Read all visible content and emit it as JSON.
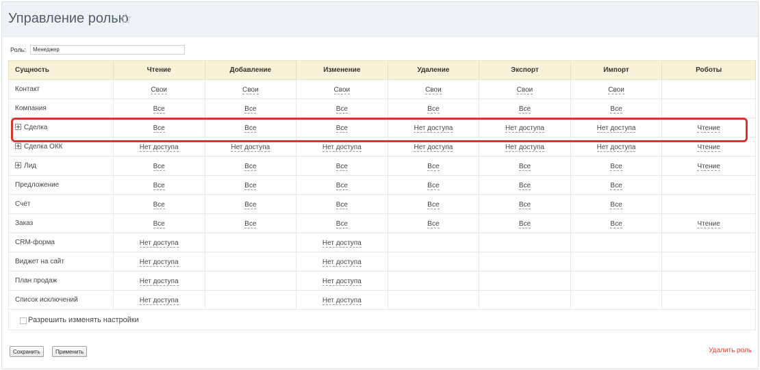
{
  "header": {
    "title": "Управление ролью"
  },
  "role": {
    "label": "Роль:",
    "value": "Менеджер"
  },
  "table": {
    "columns": [
      "Сущность",
      "Чтение",
      "Добавление",
      "Изменение",
      "Удаление",
      "Экспорт",
      "Импорт",
      "Роботы"
    ],
    "rows": [
      {
        "entity": "Контакт",
        "expandable": false,
        "cells": [
          "Свои",
          "Свои",
          "Свои",
          "Свои",
          "Свои",
          "Свои",
          ""
        ]
      },
      {
        "entity": "Компания",
        "expandable": false,
        "cells": [
          "Все",
          "Все",
          "Все",
          "Все",
          "Все",
          "Все",
          ""
        ]
      },
      {
        "entity": "Сделка",
        "expandable": true,
        "cells": [
          "Все",
          "Все",
          "Все",
          "Нет доступа",
          "Нет доступа",
          "Нет доступа",
          "Чтение"
        ]
      },
      {
        "entity": "Сделка ОКК",
        "expandable": true,
        "cells": [
          "Нет доступа",
          "Нет доступа",
          "Нет доступа",
          "Нет доступа",
          "Нет доступа",
          "Нет доступа",
          "Чтение"
        ]
      },
      {
        "entity": "Лид",
        "expandable": true,
        "cells": [
          "Все",
          "Все",
          "Все",
          "Все",
          "Все",
          "Все",
          "Чтение"
        ]
      },
      {
        "entity": "Предложение",
        "expandable": false,
        "cells": [
          "Все",
          "Все",
          "Все",
          "Все",
          "Все",
          "Все",
          ""
        ]
      },
      {
        "entity": "Счёт",
        "expandable": false,
        "cells": [
          "Все",
          "Все",
          "Все",
          "Все",
          "Все",
          "Все",
          ""
        ]
      },
      {
        "entity": "Заказ",
        "expandable": false,
        "cells": [
          "Все",
          "Все",
          "Все",
          "Все",
          "Все",
          "Все",
          "Чтение"
        ]
      },
      {
        "entity": "CRM-форма",
        "expandable": false,
        "cells": [
          "Нет доступа",
          "",
          "Нет доступа",
          "",
          "",
          "",
          ""
        ]
      },
      {
        "entity": "Виджет на сайт",
        "expandable": false,
        "cells": [
          "Нет доступа",
          "",
          "Нет доступа",
          "",
          "",
          "",
          ""
        ]
      },
      {
        "entity": "План продаж",
        "expandable": false,
        "cells": [
          "Нет доступа",
          "",
          "Нет доступа",
          "",
          "",
          "",
          ""
        ]
      },
      {
        "entity": "Список исключений",
        "expandable": false,
        "cells": [
          "Нет доступа",
          "",
          "Нет доступа",
          "",
          "",
          "",
          ""
        ]
      }
    ]
  },
  "allow_settings": {
    "label": "Разрешить изменять настройки",
    "checked": false
  },
  "buttons": {
    "save": "Сохранить",
    "apply": "Применить",
    "delete": "Удалить роль"
  },
  "colors": {
    "accent_red": "#d9342b",
    "header_bg": "#f7f1d8",
    "delete_link": "#e53a2e"
  },
  "icons": {
    "favorite": "star-icon",
    "expand": "expand-plus-icon"
  }
}
